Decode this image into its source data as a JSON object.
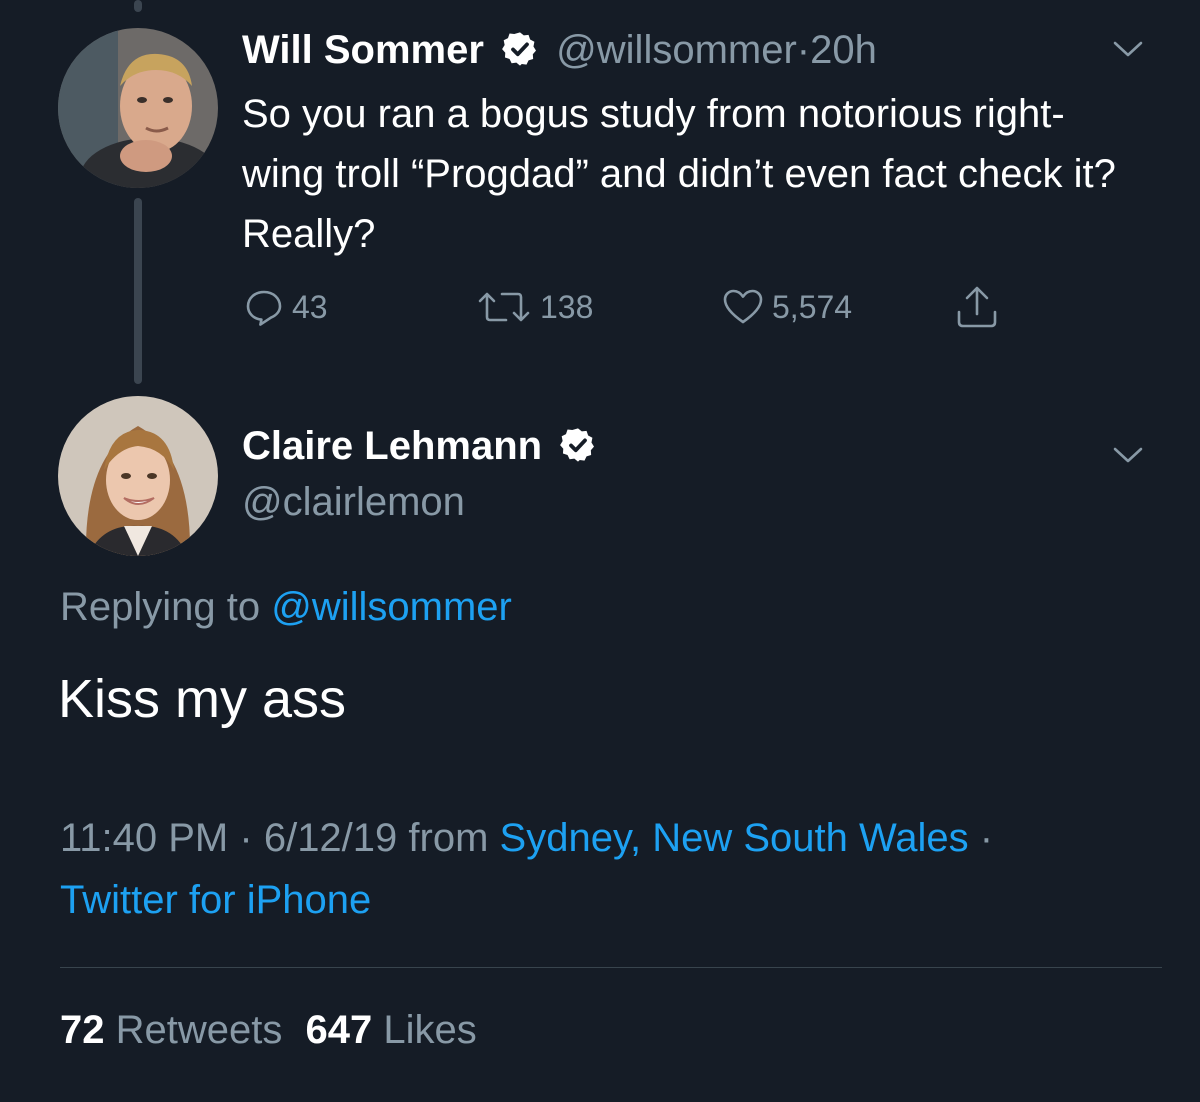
{
  "parent_tweet": {
    "author_name": "Will Sommer",
    "handle": "@willsommer",
    "separator": "·",
    "time_ago": "20h",
    "text": "So you ran a bogus study from notorious right-wing troll “Progdad” and didn’t even fact check it? Really?",
    "reply_count": "43",
    "retweet_count": "138",
    "like_count": "5,574"
  },
  "main_tweet": {
    "author_name": "Claire Lehmann",
    "handle": "@clairlemon",
    "replying_prefix": "Replying to",
    "replying_to": "@willsommer",
    "text": "Kiss my ass",
    "time": "11:40 PM",
    "separator": "·",
    "date": "6/12/19",
    "from_word": "from",
    "location": "Sydney, New South Wales",
    "trailing_separator": "·",
    "client": "Twitter for iPhone",
    "retweets_count": "72",
    "retweets_label": "Retweets",
    "likes_count": "647",
    "likes_label": "Likes"
  },
  "colors": {
    "background": "#151c26",
    "link": "#1da1f2",
    "muted": "#8899a6",
    "text": "#ffffff"
  }
}
